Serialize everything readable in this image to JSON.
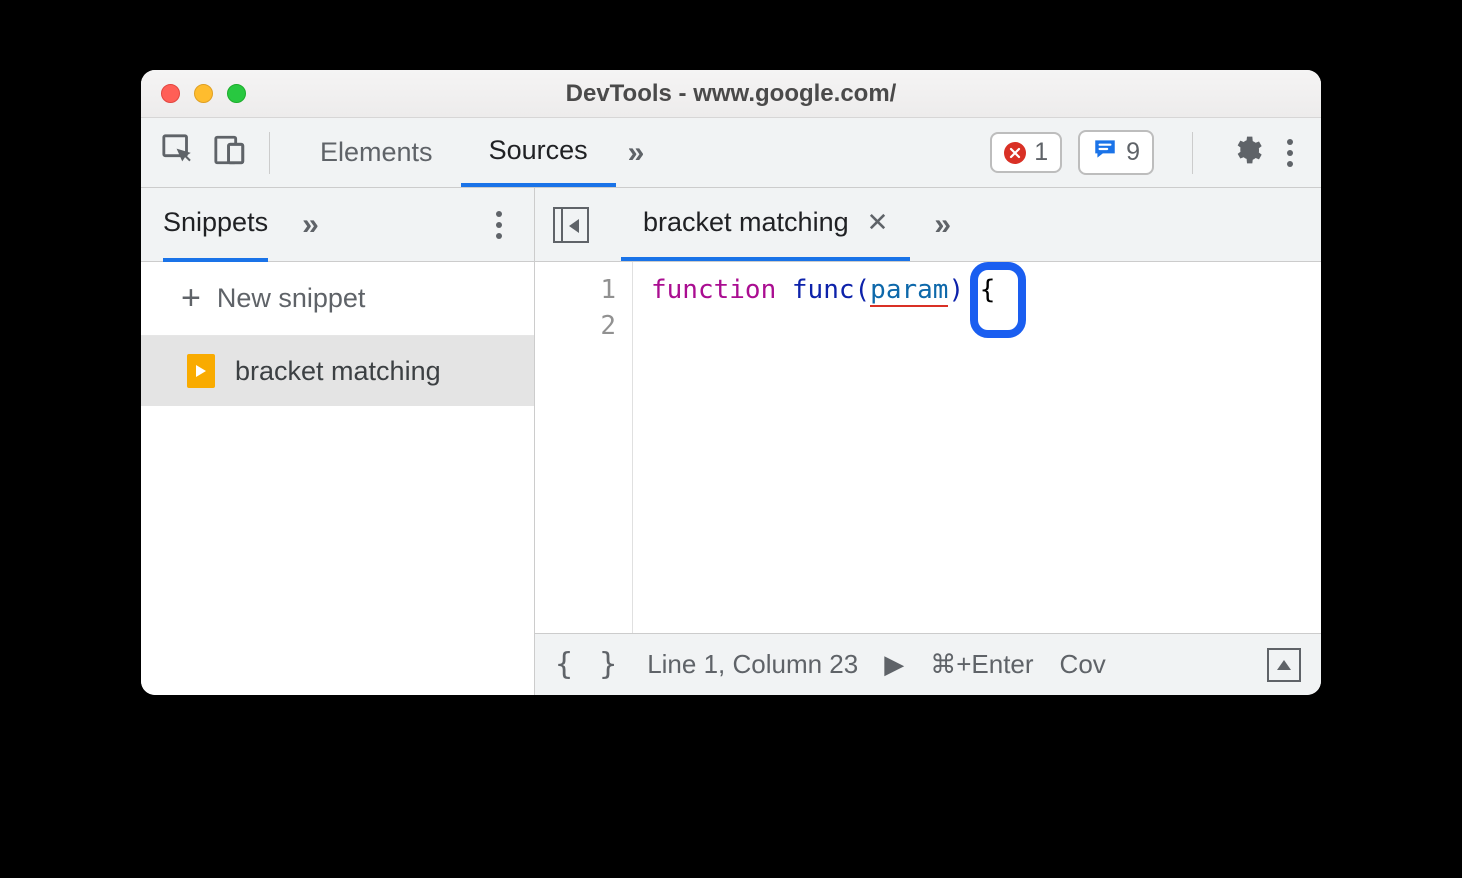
{
  "window": {
    "title": "DevTools - www.google.com/"
  },
  "toolbar": {
    "tabs": {
      "elements": "Elements",
      "sources": "Sources"
    },
    "errors_count": "1",
    "messages_count": "9"
  },
  "sidebar": {
    "tab_label": "Snippets",
    "new_snippet_label": "New snippet",
    "items": [
      {
        "label": "bracket matching"
      }
    ]
  },
  "editor": {
    "open_file": "bracket matching",
    "line_numbers": {
      "l1": "1",
      "l2": "2"
    },
    "code": {
      "kw": "function",
      "fn": "func",
      "open_paren": "(",
      "param": "param",
      "close_paren": ")",
      "space": " ",
      "brace": "{"
    }
  },
  "statusbar": {
    "braces": "{ }",
    "position": "Line 1, Column 23",
    "run_icon": "▶",
    "run_shortcut": "⌘+Enter",
    "coverage": "Cov"
  }
}
